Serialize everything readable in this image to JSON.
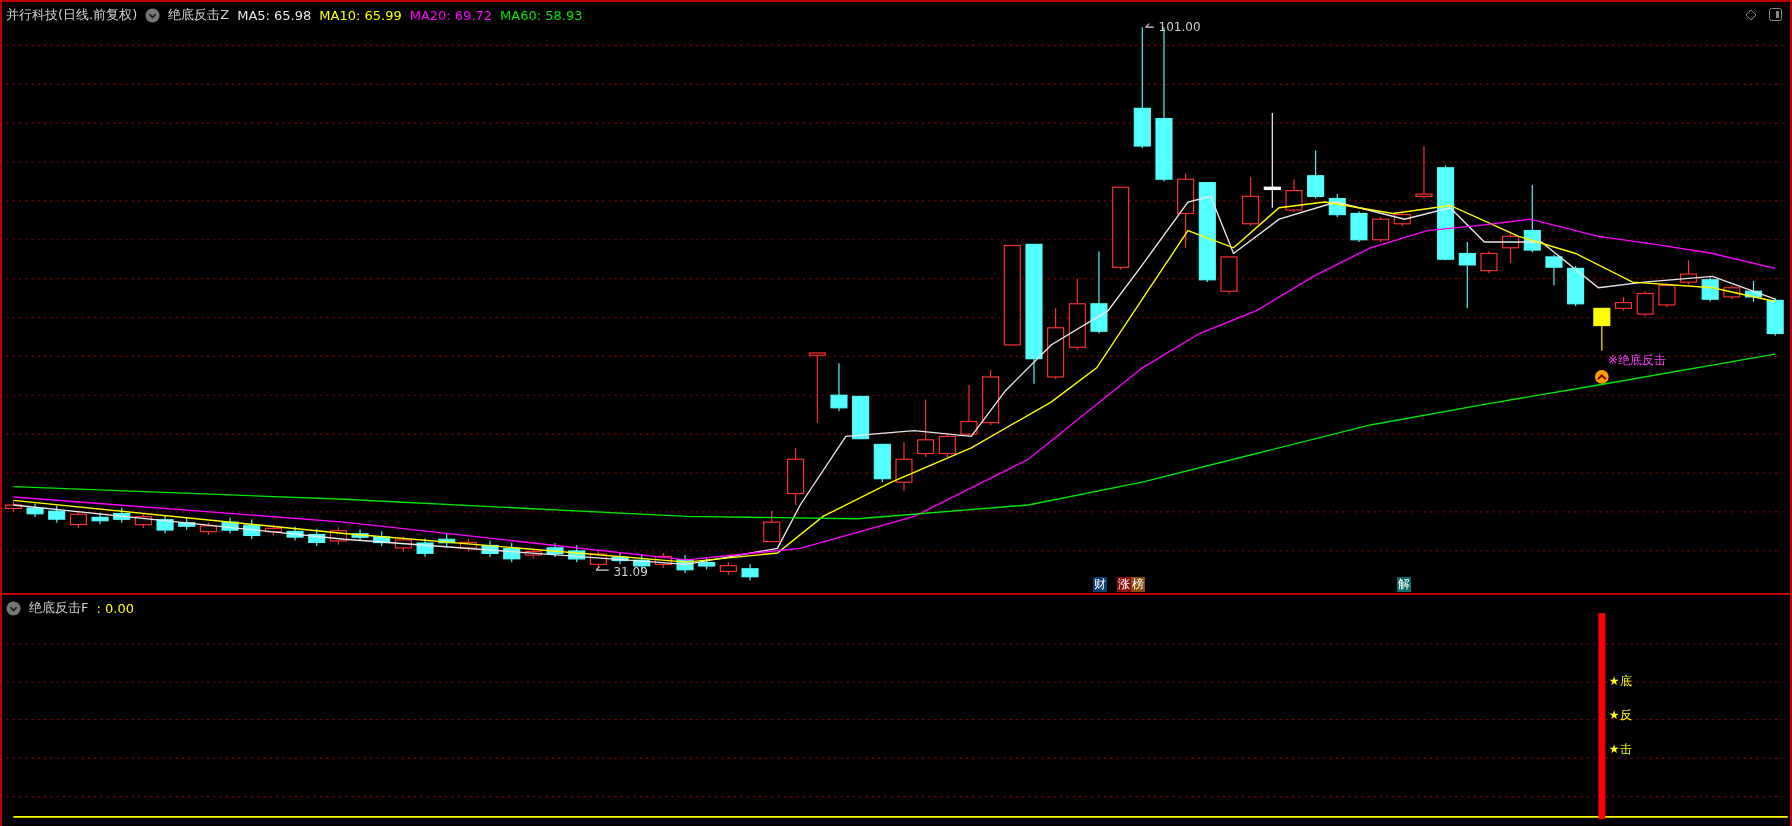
{
  "main_panel": {
    "stock_title": "并行科技(日线.前复权)",
    "indicator": "绝底反击Z",
    "moving_averages": [
      {
        "label": "MA5: 65.98",
        "color": "#e8e8e8"
      },
      {
        "label": "MA10: 65.99",
        "color": "#ffff00"
      },
      {
        "label": "MA20: 69.72",
        "color": "#ff00ff"
      },
      {
        "label": "MA60: 58.93",
        "color": "#00e600"
      }
    ],
    "high_label": "101.00",
    "low_label": "31.09",
    "signal_label": "※绝底反击",
    "event_badges": [
      {
        "text": "财",
        "color": "#0c3d6e"
      },
      {
        "text": "涨",
        "color": "#8b0f0f"
      },
      {
        "text": "榜",
        "color": "#8a4a0c"
      },
      {
        "text": "解",
        "color": "#0b6b6b"
      }
    ]
  },
  "lower_panel": {
    "indicator": "绝底反击F",
    "value": ": 0.00",
    "signal_stars": [
      "★底",
      "★反",
      "★击"
    ]
  }
}
